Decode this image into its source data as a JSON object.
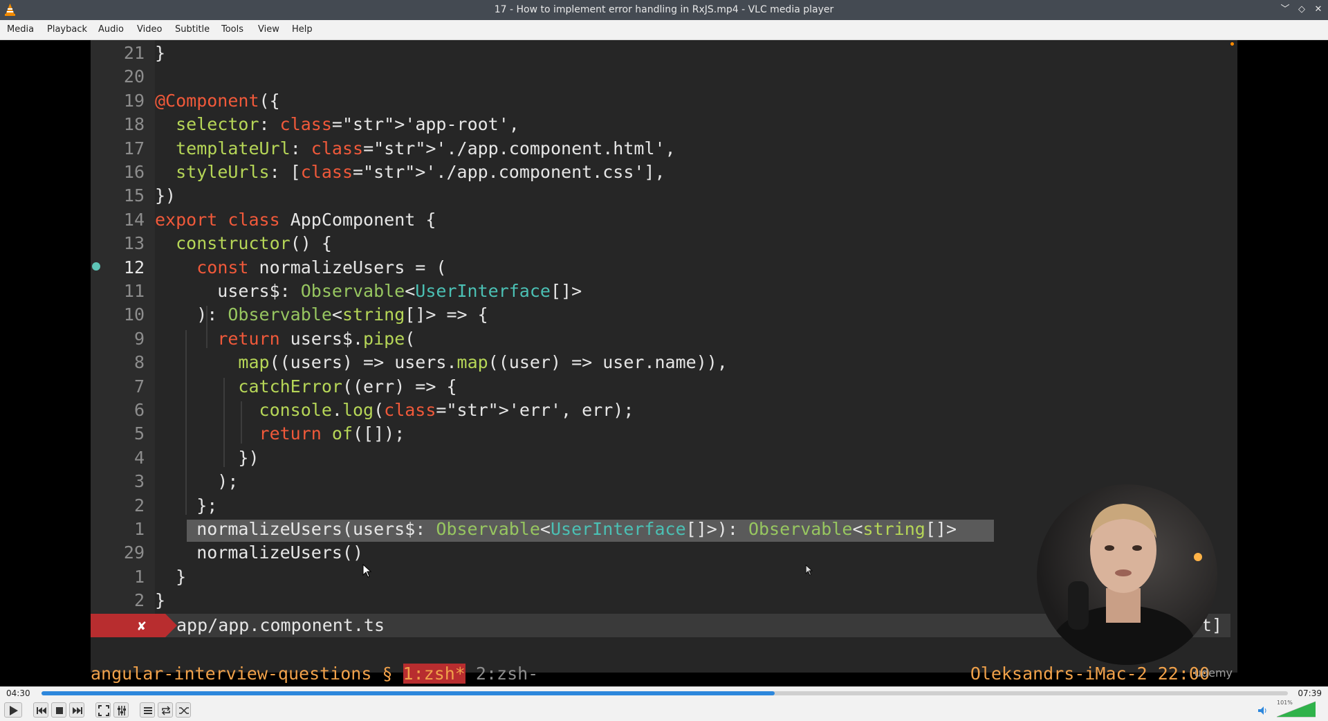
{
  "window": {
    "title": "17 - How to implement error handling in RxJS.mp4 - VLC media player",
    "icon": "vlc-cone-icon",
    "minimize": "﹀",
    "restore": "◇",
    "close": "✕"
  },
  "menu": [
    "Media",
    "Playback",
    "Audio",
    "Video",
    "Subtitle",
    "Tools",
    "View",
    "Help"
  ],
  "editor": {
    "lines": [
      {
        "n": "21",
        "t": "}"
      },
      {
        "n": "20",
        "t": ""
      },
      {
        "n": "19",
        "t": "@Component({"
      },
      {
        "n": "18",
        "t": "  selector: 'app-root',"
      },
      {
        "n": "17",
        "t": "  templateUrl: './app.component.html',"
      },
      {
        "n": "16",
        "t": "  styleUrls: ['./app.component.css'],"
      },
      {
        "n": "15",
        "t": "})"
      },
      {
        "n": "14",
        "t": "export class AppComponent {"
      },
      {
        "n": "13",
        "t": "  constructor() {"
      },
      {
        "n": "12",
        "t": "    const normalizeUsers = ("
      },
      {
        "n": "11",
        "t": "      users$: Observable<UserInterface[]>"
      },
      {
        "n": "10",
        "t": "    ): Observable<string[]> => {"
      },
      {
        "n": "9",
        "t": "      return users$.pipe("
      },
      {
        "n": "8",
        "t": "        map((users) => users.map((user) => user.name)),"
      },
      {
        "n": "7",
        "t": "        catchError((err) => {"
      },
      {
        "n": "6",
        "t": "          console.log('err', err);"
      },
      {
        "n": "5",
        "t": "          return of([]);"
      },
      {
        "n": "4",
        "t": "        })"
      },
      {
        "n": "3",
        "t": "      );"
      },
      {
        "n": "2",
        "t": "    };"
      },
      {
        "n": "1",
        "t": "    normalizeUsers(users$: Observable<UserInterface[]>): Observable<string[]>"
      },
      {
        "n": "29",
        "t": "    normalizeUsers()"
      },
      {
        "n": "1",
        "t": "  }"
      },
      {
        "n": "2",
        "t": "}"
      }
    ],
    "status_error": "✘",
    "status_file": "app/app.component.ts",
    "status_tail": "t]"
  },
  "tmux": {
    "session": "angular-interview-questions",
    "sep": " § ",
    "window1": "1:zsh*",
    "window2": " 2:zsh-",
    "host": "Oleksandrs-iMac-2 22:00"
  },
  "watermark": "udemy",
  "playback": {
    "elapsed": "04:30",
    "total": "07:39",
    "progress": 0.588,
    "volume_label": "101%",
    "volume": 1.01
  },
  "controls": [
    "play-button",
    "previous-button",
    "stop-button",
    "next-button",
    "fullscreen-button",
    "extended-settings-button",
    "playlist-button",
    "loop-button",
    "shuffle-button"
  ]
}
